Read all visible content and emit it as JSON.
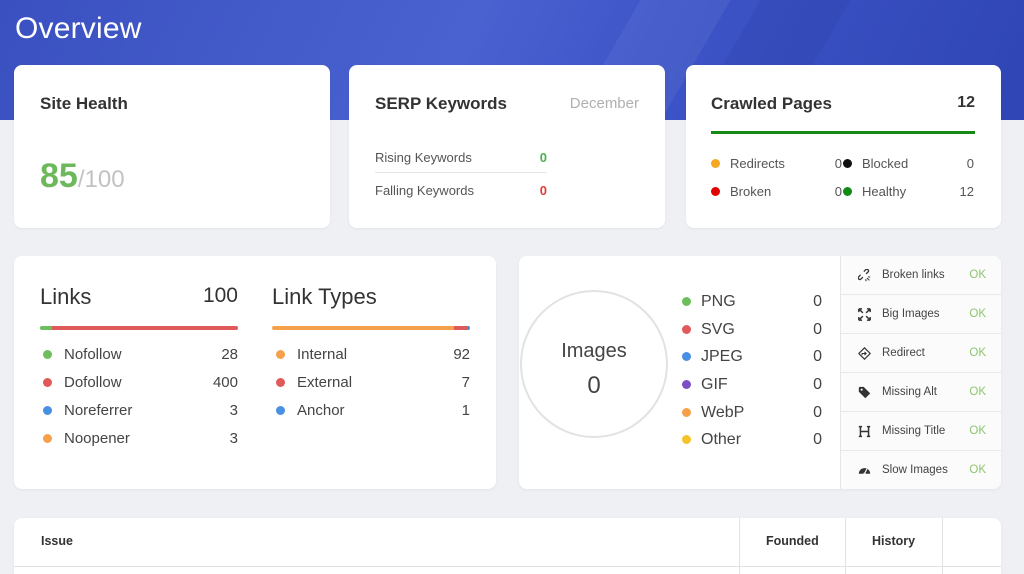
{
  "page": {
    "title": "Overview"
  },
  "site_health": {
    "title": "Site Health",
    "score": "85",
    "max": "/100"
  },
  "serp": {
    "title": "SERP Keywords",
    "month": "December",
    "rows": [
      {
        "label": "Rising Keywords",
        "value": "0",
        "color": "#4caf50"
      },
      {
        "label": "Falling Keywords",
        "value": "0",
        "color": "#e53935"
      }
    ]
  },
  "crawled": {
    "title": "Crawled Pages",
    "total": "12",
    "stats": [
      {
        "label": "Redirects",
        "value": "0",
        "color": "#f5a623"
      },
      {
        "label": "Blocked",
        "value": "0",
        "color": "#111111"
      },
      {
        "label": "Broken",
        "value": "0",
        "color": "#e00000"
      },
      {
        "label": "Healthy",
        "value": "12",
        "color": "#138a13"
      }
    ]
  },
  "links": {
    "title": "Links",
    "total": "100",
    "items": [
      {
        "label": "Nofollow",
        "value": "28",
        "color": "#6cbf5a"
      },
      {
        "label": "Dofollow",
        "value": "400",
        "color": "#e05a5a"
      },
      {
        "label": "Noreferrer",
        "value": "3",
        "color": "#4a90e2"
      },
      {
        "label": "Noopener",
        "value": "3",
        "color": "#f5a04a"
      }
    ]
  },
  "link_types": {
    "title": "Link Types",
    "items": [
      {
        "label": "Internal",
        "value": "92",
        "color": "#f5a04a"
      },
      {
        "label": "External",
        "value": "7",
        "color": "#e05a5a"
      },
      {
        "label": "Anchor",
        "value": "1",
        "color": "#4a90e2"
      }
    ]
  },
  "images": {
    "label": "Images",
    "total": "0",
    "items": [
      {
        "label": "PNG",
        "value": "0",
        "color": "#6cbf5a"
      },
      {
        "label": "SVG",
        "value": "0",
        "color": "#e05a5a"
      },
      {
        "label": "JPEG",
        "value": "0",
        "color": "#4a90e2"
      },
      {
        "label": "GIF",
        "value": "0",
        "color": "#7e4fc4"
      },
      {
        "label": "WebP",
        "value": "0",
        "color": "#f5a04a"
      },
      {
        "label": "Other",
        "value": "0",
        "color": "#f5c32a"
      }
    ],
    "checks": [
      {
        "label": "Broken links",
        "status": "OK",
        "icon": "broken-link-icon"
      },
      {
        "label": "Big Images",
        "status": "OK",
        "icon": "expand-icon"
      },
      {
        "label": "Redirect",
        "status": "OK",
        "icon": "redirect-icon"
      },
      {
        "label": "Missing Alt",
        "status": "OK",
        "icon": "tag-icon"
      },
      {
        "label": "Missing Title",
        "status": "OK",
        "icon": "heading-icon"
      },
      {
        "label": "Slow Images",
        "status": "OK",
        "icon": "gauge-icon"
      }
    ]
  },
  "issues_table": {
    "columns": [
      "Issue",
      "Founded",
      "History"
    ]
  },
  "colors": {
    "banner": "#3d55c8",
    "health_score": "#6cb85a",
    "ok": "#8cc66e",
    "crawled_bar": "#148a14"
  }
}
